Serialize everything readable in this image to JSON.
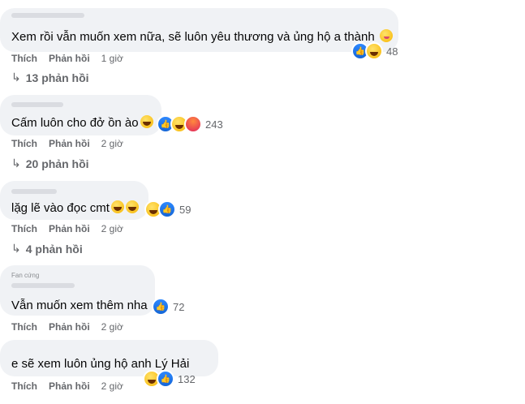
{
  "actions": {
    "like": "Thích",
    "reply": "Phản hồi"
  },
  "comments": [
    {
      "text": "Xem rồi vẫn muốn xem nữa, sẽ luôn yêu thương và ủng hộ a thành",
      "emojis": [
        "wink"
      ],
      "reactions": [
        "like",
        "haha"
      ],
      "count": "48",
      "time": "1 giờ",
      "replies": "13 phản hồi"
    },
    {
      "text": "Cấm luôn cho đở ồn ào",
      "emojis": [
        "laugh"
      ],
      "reactions": [
        "like",
        "haha",
        "angry"
      ],
      "count": "243",
      "time": "2 giờ",
      "replies": "20 phản hồi"
    },
    {
      "text": "lặg lẽ vào đọc cmt",
      "emojis": [
        "laugh",
        "laugh"
      ],
      "reactions": [
        "haha",
        "like"
      ],
      "count": "59",
      "time": "2 giờ",
      "replies": "4 phản hồi"
    },
    {
      "badge": "Fan cứng",
      "text": "Vẫn muốn xem thêm nha",
      "emojis": [],
      "reactions": [
        "like"
      ],
      "count": "72",
      "time": "2 giờ",
      "replies": ""
    },
    {
      "text": "e sẽ xem luôn ủng hộ anh Lý Hải",
      "emojis": [],
      "reactions": [
        "haha",
        "like"
      ],
      "count": "132",
      "time": "2 giờ",
      "replies": ""
    }
  ]
}
